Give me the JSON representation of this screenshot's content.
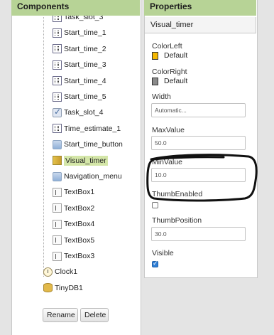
{
  "components_panel": {
    "title": "Components",
    "items": [
      {
        "label": "Task_slot_3",
        "icon": "time-format-icon"
      },
      {
        "label": "Start_time_1",
        "icon": "time-format-icon"
      },
      {
        "label": "Start_time_2",
        "icon": "time-format-icon"
      },
      {
        "label": "Start_time_3",
        "icon": "time-format-icon"
      },
      {
        "label": "Start_time_4",
        "icon": "time-format-icon"
      },
      {
        "label": "Start_time_5",
        "icon": "time-format-icon"
      },
      {
        "label": "Task_slot_4",
        "icon": "checkbox-icon"
      },
      {
        "label": "Time_estimate_1",
        "icon": "time-format-icon"
      },
      {
        "label": "Start_time_button",
        "icon": "button-icon"
      },
      {
        "label": "Visual_timer",
        "icon": "slider-icon",
        "selected": true
      },
      {
        "label": "Navigation_menu",
        "icon": "button-icon"
      },
      {
        "label": "TextBox1",
        "icon": "textbox-icon"
      },
      {
        "label": "TextBox2",
        "icon": "textbox-icon"
      },
      {
        "label": "TextBox4",
        "icon": "textbox-icon"
      },
      {
        "label": "TextBox5",
        "icon": "textbox-icon"
      },
      {
        "label": "TextBox3",
        "icon": "textbox-icon"
      },
      {
        "label": "Clock1",
        "icon": "clock-icon"
      },
      {
        "label": "TinyDB1",
        "icon": "database-icon"
      }
    ],
    "rename_label": "Rename",
    "delete_label": "Delete"
  },
  "properties_panel": {
    "title": "Properties",
    "component_name": "Visual_timer",
    "color_left": {
      "label": "ColorLeft",
      "value": "Default",
      "color": "#f5b800"
    },
    "color_right": {
      "label": "ColorRight",
      "value": "Default",
      "color": "#8a8a8a"
    },
    "width": {
      "label": "Width",
      "value": "Automatic..."
    },
    "max_value": {
      "label": "MaxValue",
      "value": "50.0"
    },
    "min_value": {
      "label": "MinValue",
      "value": "10.0"
    },
    "thumb_enabled": {
      "label": "ThumbEnabled",
      "checked": false
    },
    "thumb_position": {
      "label": "ThumbPosition",
      "value": "30.0"
    },
    "visible": {
      "label": "Visible",
      "checked": true
    }
  },
  "colors": {
    "header_green": "#b7d396",
    "selection_green": "#d4e6a8",
    "annotation_ink": "#111111"
  }
}
